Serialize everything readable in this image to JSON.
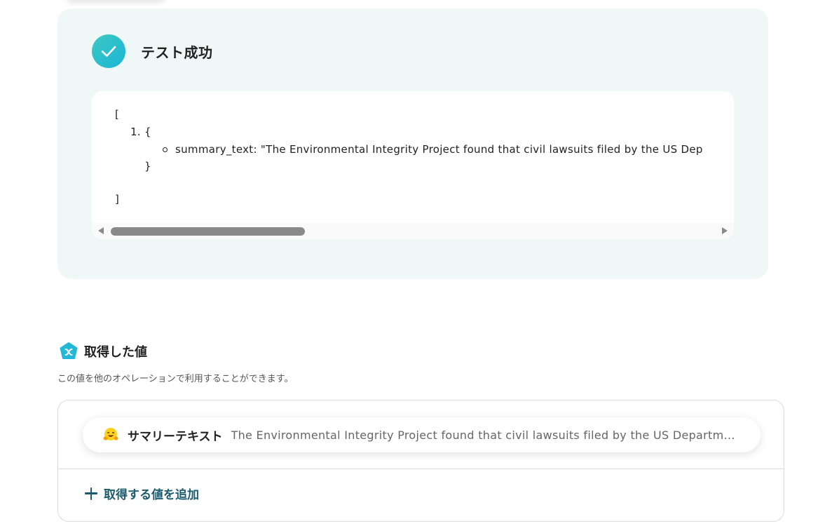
{
  "test_result": {
    "title": "テスト成功",
    "json_lines": {
      "open_bracket": "[",
      "item_index": "1.",
      "open_brace": "{",
      "summary_line": "summary_text: \"The Environmental Integrity Project found that civil lawsuits filed by the US Dep",
      "close_brace": "}",
      "close_bracket": "]"
    },
    "scroll_position": 0
  },
  "acquired_values": {
    "title": "取得した値",
    "description": "この値を他のオペレーションで利用することができます。",
    "items": [
      {
        "emoji": "hugging-face-emoji",
        "label": "サマリーテキスト",
        "value": "The Environmental Integrity Project found that civil lawsuits filed by the US Departmen..."
      }
    ],
    "add_button_label": "取得する値を追加"
  },
  "colors": {
    "panel_bg": "#eff8f7",
    "check_gradient_start": "#3ec9c2",
    "check_gradient_end": "#19b5d6",
    "accent_text": "#1c5b6e",
    "section_icon": "#23b8d8"
  }
}
